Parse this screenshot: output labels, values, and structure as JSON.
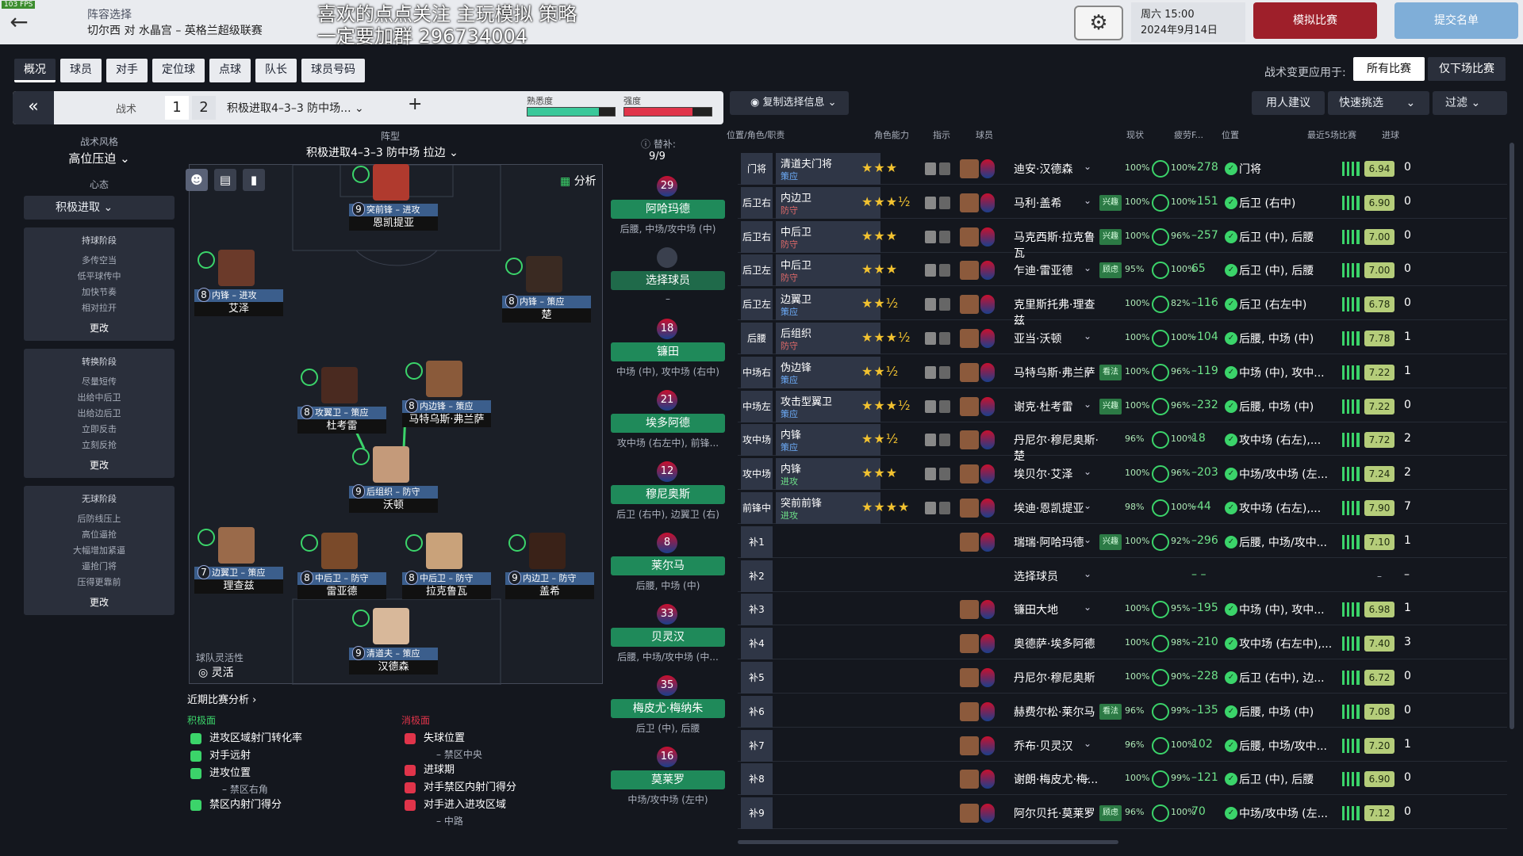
{
  "topbar": {
    "fps": "103 FPS",
    "context": "阵容选择",
    "match": "切尔西 对 水晶宫 – 英格兰超级联赛",
    "banner_line1": "喜欢的点点关注 主玩模拟 策略",
    "banner_line2": "一定要加群 296734004",
    "day_time": "周六 15:00",
    "date": "2024年9月14日",
    "simulate": "模拟比赛",
    "submit": "提交名单"
  },
  "tabs": [
    "概况",
    "球员",
    "对手",
    "定位球",
    "点球",
    "队长",
    "球员号码"
  ],
  "apply": {
    "label": "战术变更应用于:",
    "all": "所有比赛",
    "next": "仅下场比赛"
  },
  "tactic": {
    "label": "战术",
    "slot1": "1",
    "slot2": "2",
    "name": "积极进取4–3–3 防中场...",
    "familiarity_label": "熟悉度",
    "intensity_label": "强度",
    "familiarity": 0.82,
    "intensity": 0.78
  },
  "left": {
    "style_label": "战术风格",
    "style_value": "高位压迫",
    "mentality_label": "心态",
    "mentality_value": "积极进取",
    "phases": [
      {
        "title": "持球阶段",
        "items": [
          "多传空当",
          "低平球传中",
          "加快节奏",
          "相对拉开"
        ],
        "more": "更改"
      },
      {
        "title": "转换阶段",
        "items": [
          "尽量短传",
          "出给中后卫",
          "出给边后卫",
          "立即反击",
          "立刻反抢"
        ],
        "more": "更改"
      },
      {
        "title": "无球阶段",
        "items": [
          "后防线压上",
          "高位逼抢",
          "大幅增加紧逼",
          "逼抢门将",
          "压得更靠前"
        ],
        "more": "更改"
      }
    ]
  },
  "pitch": {
    "formation_label": "阵型",
    "formation_name": "积极进取4–3–3 防中场 拉边",
    "analyze": "分析",
    "flex_label": "球队灵活性",
    "flex_value": "灵活",
    "players": [
      {
        "num": "9",
        "role": "突前锋 – 进攻",
        "name": "恩凯提亚"
      },
      {
        "num": "8",
        "role": "内锋 – 进攻",
        "name": "艾泽"
      },
      {
        "num": "8",
        "role": "内锋 – 策应",
        "name": "楚"
      },
      {
        "num": "8",
        "role": "攻翼卫 – 策应",
        "name": "杜考雷"
      },
      {
        "num": "8",
        "role": "内边锋 – 策应",
        "name": "马特乌斯·弗兰萨"
      },
      {
        "num": "9",
        "role": "后组织 – 防守",
        "name": "沃顿"
      },
      {
        "num": "7",
        "role": "边翼卫 – 策应",
        "name": "理查兹"
      },
      {
        "num": "8",
        "role": "中后卫 – 防守",
        "name": "雷亚德"
      },
      {
        "num": "8",
        "role": "中后卫 – 防守",
        "name": "拉克鲁瓦"
      },
      {
        "num": "9",
        "role": "内边卫 – 防守",
        "name": "盖希"
      },
      {
        "num": "9",
        "role": "清道夫 – 策应",
        "name": "汉德森"
      }
    ]
  },
  "recent": {
    "title": "近期比赛分析",
    "pos_title": "积极面",
    "neg_title": "消极面",
    "pos": [
      {
        "t": "进攻区域射门转化率",
        "s": ""
      },
      {
        "t": "对手远射",
        "s": ""
      },
      {
        "t": "进攻位置",
        "s": "– 禁区右角"
      },
      {
        "t": "禁区内射门得分",
        "s": ""
      }
    ],
    "neg": [
      {
        "t": "失球位置",
        "s": "– 禁区中央"
      },
      {
        "t": "进球期",
        "s": ""
      },
      {
        "t": "对手禁区内射门得分",
        "s": ""
      },
      {
        "t": "对手进入进攻区域",
        "s": "– 中路"
      }
    ]
  },
  "subs": {
    "label": "替补:",
    "count": "9/9",
    "items": [
      {
        "num": "29",
        "name": "阿哈玛德",
        "pos": "后腰, 中场/攻中场 (中)"
      },
      {
        "num": "",
        "name": "选择球员",
        "pos": "–"
      },
      {
        "num": "18",
        "name": "镰田",
        "pos": "中场 (中), 攻中场 (右中)"
      },
      {
        "num": "21",
        "name": "埃多阿德",
        "pos": "攻中场 (右左中), 前锋..."
      },
      {
        "num": "12",
        "name": "穆尼奥斯",
        "pos": "后卫 (右中), 边翼卫 (右)"
      },
      {
        "num": "8",
        "name": "莱尔马",
        "pos": "后腰, 中场 (中)"
      },
      {
        "num": "33",
        "name": "贝灵汉",
        "pos": "后腰, 中场/攻中场 (中..."
      },
      {
        "num": "35",
        "name": "梅皮尤·梅纳朱",
        "pos": "后卫 (中), 后腰"
      },
      {
        "num": "16",
        "name": "莫莱罗",
        "pos": "中场/攻中场 (左中)"
      }
    ]
  },
  "table": {
    "copy": "复制选择信息",
    "suggest": "用人建议",
    "quick": "快速挑选",
    "filter": "过滤",
    "headers": [
      "位置/角色/职责",
      "角色能力",
      "指示",
      "球员",
      "现状",
      "疲劳F...",
      "位置",
      "最近5场比赛",
      "进球"
    ],
    "rows": [
      {
        "pos": "门将",
        "role": "清道夫门将",
        "duty": "策应",
        "stars": "★★★",
        "name": "迪安·汉德森",
        "tag": "",
        "cond": "100%",
        "fit": "100%",
        "diff": "–278",
        "ppos": "门将",
        "rating": "6.94",
        "goals": "0"
      },
      {
        "pos": "后卫右",
        "role": "内边卫",
        "duty": "防守",
        "stars": "★★★½",
        "name": "马利·盖希",
        "tag": "兴趣",
        "cond": "100%",
        "fit": "100%",
        "diff": "–151",
        "ppos": "后卫 (右中)",
        "rating": "6.90",
        "goals": "0"
      },
      {
        "pos": "后卫右中",
        "role": "中后卫",
        "duty": "防守",
        "stars": "★★★",
        "name": "马克西斯·拉克鲁瓦",
        "tag": "兴趣",
        "cond": "100%",
        "fit": "96%",
        "diff": "–257",
        "ppos": "后卫 (中), 后腰",
        "rating": "7.00",
        "goals": "0"
      },
      {
        "pos": "后卫左中",
        "role": "中后卫",
        "duty": "防守",
        "stars": "★★★",
        "name": "乍迪·雷亚德",
        "tag": "顾虑",
        "cond": "95%",
        "fit": "100%",
        "diff": "65",
        "ppos": "后卫 (中), 后腰",
        "rating": "7.00",
        "goals": "0"
      },
      {
        "pos": "后卫左",
        "role": "边翼卫",
        "duty": "策应",
        "stars": "★★½",
        "name": "克里斯托弗·理查兹",
        "tag": "",
        "cond": "100%",
        "fit": "82%",
        "diff": "–116",
        "ppos": "后卫 (右左中)",
        "rating": "6.78",
        "goals": "0"
      },
      {
        "pos": "后腰",
        "role": "后组织",
        "duty": "防守",
        "stars": "★★★½",
        "name": "亚当·沃顿",
        "tag": "",
        "cond": "100%",
        "fit": "100%",
        "diff": "–104",
        "ppos": "后腰, 中场 (中)",
        "rating": "7.78",
        "goals": "1"
      },
      {
        "pos": "中场右",
        "role": "伪边锋",
        "duty": "策应",
        "stars": "★★½",
        "name": "马特乌斯·弗兰萨",
        "tag": "看法",
        "cond": "100%",
        "fit": "96%",
        "diff": "–119",
        "ppos": "中场 (中), 攻中...",
        "rating": "7.22",
        "goals": "1"
      },
      {
        "pos": "中场左",
        "role": "攻击型翼卫",
        "duty": "策应",
        "stars": "★★★½",
        "name": "谢克·杜考雷",
        "tag": "兴趣",
        "cond": "100%",
        "fit": "96%",
        "diff": "–232",
        "ppos": "后腰, 中场 (中)",
        "rating": "7.22",
        "goals": "0"
      },
      {
        "pos": "攻中场右",
        "role": "内锋",
        "duty": "策应",
        "stars": "★★½",
        "name": "丹尼尔·穆尼奥斯·楚",
        "tag": "",
        "cond": "96%",
        "fit": "100%",
        "diff": "18",
        "ppos": "攻中场 (右左),...",
        "rating": "7.72",
        "goals": "2"
      },
      {
        "pos": "攻中场左",
        "role": "内锋",
        "duty": "进攻",
        "stars": "★★★",
        "name": "埃贝尔·艾泽",
        "tag": "",
        "cond": "100%",
        "fit": "96%",
        "diff": "–203",
        "ppos": "中场/攻中场 (左...",
        "rating": "7.24",
        "goals": "2"
      },
      {
        "pos": "前锋中",
        "role": "突前前锋",
        "duty": "进攻",
        "stars": "★★★★",
        "name": "埃迪·恩凯提亚",
        "tag": "",
        "cond": "98%",
        "fit": "100%",
        "diff": "–44",
        "ppos": "攻中场 (右左),...",
        "rating": "7.90",
        "goals": "7"
      },
      {
        "pos": "补1",
        "role": "",
        "duty": "",
        "stars": "",
        "name": "瑞瑞·阿哈玛德",
        "tag": "兴趣",
        "cond": "100%",
        "fit": "92%",
        "diff": "–296",
        "ppos": "后腰, 中场/攻中...",
        "rating": "7.10",
        "goals": "1"
      },
      {
        "pos": "补2",
        "role": "",
        "duty": "",
        "stars": "",
        "name": "选择球员",
        "tag": "",
        "cond": "",
        "fit": "",
        "diff": "– –",
        "ppos": "",
        "rating": "–",
        "goals": "–"
      },
      {
        "pos": "补3",
        "role": "",
        "duty": "",
        "stars": "",
        "name": "镰田大地",
        "tag": "",
        "cond": "100%",
        "fit": "95%",
        "diff": "–195",
        "ppos": "中场 (中), 攻中...",
        "rating": "6.98",
        "goals": "1"
      },
      {
        "pos": "补4",
        "role": "",
        "duty": "",
        "stars": "",
        "name": "奥德萨·埃多阿德",
        "tag": "",
        "cond": "100%",
        "fit": "98%",
        "diff": "–210",
        "ppos": "攻中场 (右左中),...",
        "rating": "7.40",
        "goals": "3"
      },
      {
        "pos": "补5",
        "role": "",
        "duty": "",
        "stars": "",
        "name": "丹尼尔·穆尼奥斯",
        "tag": "",
        "cond": "100%",
        "fit": "90%",
        "diff": "–228",
        "ppos": "后卫 (右中), 边...",
        "rating": "6.72",
        "goals": "0"
      },
      {
        "pos": "补6",
        "role": "",
        "duty": "",
        "stars": "",
        "name": "赫费尔松·莱尔马",
        "tag": "看法",
        "cond": "96%",
        "fit": "99%",
        "diff": "–135",
        "ppos": "后腰, 中场 (中)",
        "rating": "7.08",
        "goals": "0"
      },
      {
        "pos": "补7",
        "role": "",
        "duty": "",
        "stars": "",
        "name": "乔布·贝灵汉",
        "tag": "",
        "cond": "96%",
        "fit": "100%",
        "diff": "102",
        "ppos": "后腰, 中场/攻中...",
        "rating": "7.20",
        "goals": "1"
      },
      {
        "pos": "补8",
        "role": "",
        "duty": "",
        "stars": "",
        "name": "谢朗·梅皮尤·梅...",
        "tag": "",
        "cond": "100%",
        "fit": "99%",
        "diff": "–121",
        "ppos": "后卫 (中), 后腰",
        "rating": "6.90",
        "goals": "0"
      },
      {
        "pos": "补9",
        "role": "",
        "duty": "",
        "stars": "",
        "name": "阿尔贝托·莫莱罗",
        "tag": "顾虑",
        "cond": "96%",
        "fit": "100%",
        "diff": "70",
        "ppos": "中场/攻中场 (左...",
        "rating": "7.12",
        "goals": "0"
      }
    ]
  },
  "colors": {
    "accent": "#3bd46a",
    "sim_button": "#9e1f2a",
    "submit_button": "#7faed8",
    "role_blue": "#3b5e8c",
    "rating_green": "#b5cd7a"
  }
}
